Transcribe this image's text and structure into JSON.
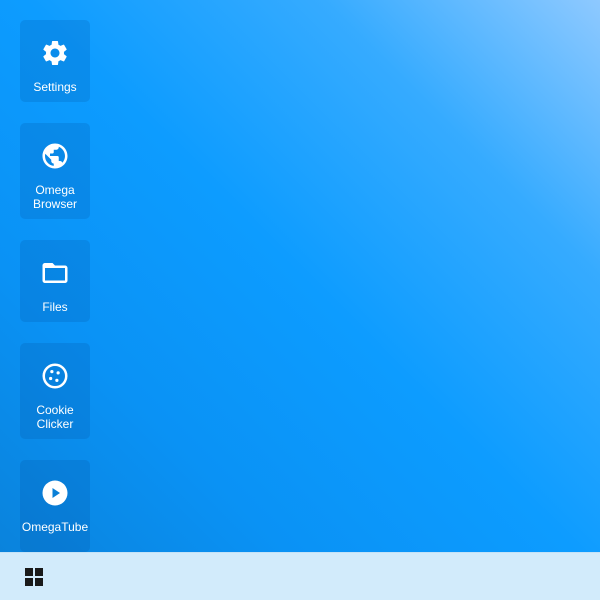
{
  "desktop": {
    "icons": [
      {
        "label": "Settings",
        "icon": "gear-icon"
      },
      {
        "label": "Omega\nBrowser",
        "icon": "globe-icon"
      },
      {
        "label": "Files",
        "icon": "folder-icon"
      },
      {
        "label": "Cookie\nClicker",
        "icon": "cookie-icon"
      },
      {
        "label": "OmegaTube",
        "icon": "play-circle-icon"
      }
    ]
  },
  "taskbar": {
    "start_icon": "grid-icon"
  },
  "colors": {
    "wallpaper_light": "#8ec9ff",
    "wallpaper_mid": "#0d9cff",
    "wallpaper_dark": "#0a83dc",
    "taskbar": "#d2ebfb",
    "icon_tile": "#0a7fd6",
    "label_text": "#ffffff"
  }
}
